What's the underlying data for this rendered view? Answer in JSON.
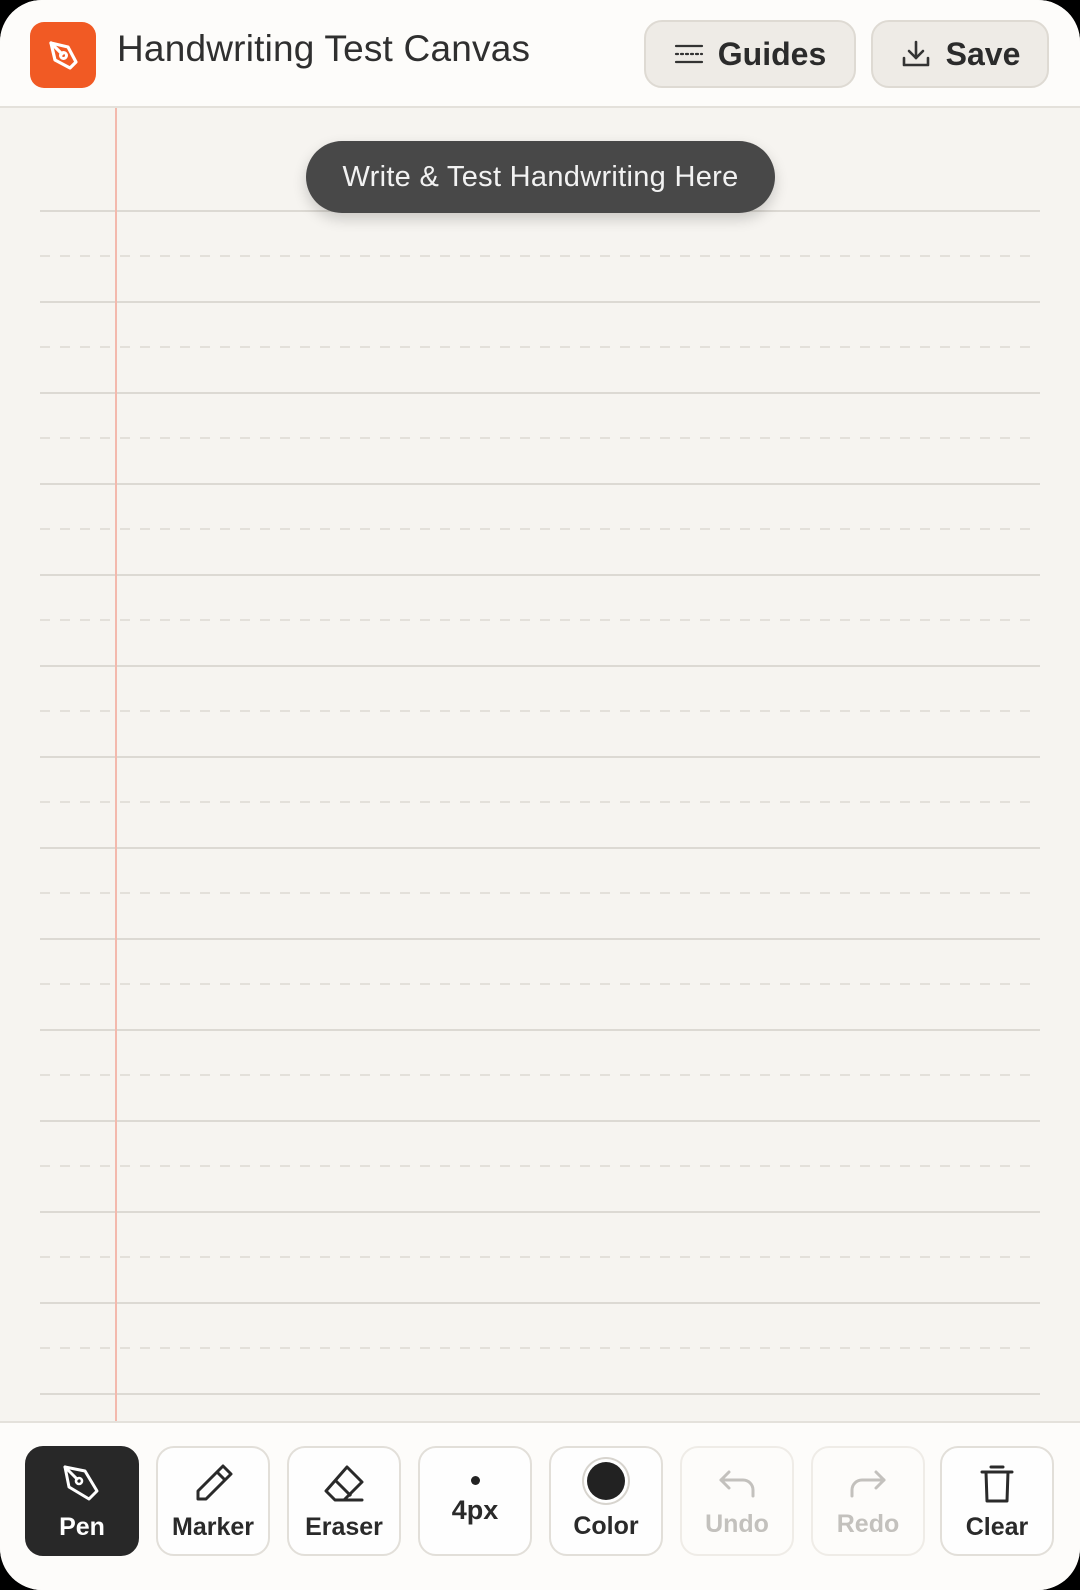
{
  "header": {
    "title": "Handwriting Test Canvas",
    "guides_label": "Guides",
    "save_label": "Save",
    "logo_icon": "pen-nib-icon",
    "accent_color": "#f15a24"
  },
  "canvas": {
    "banner_text": "Write & Test Handwriting Here",
    "paper_color": "#f6f4f0",
    "margin_line_color": "#f3b9ad"
  },
  "toolbar": {
    "pen_label": "Pen",
    "marker_label": "Marker",
    "eraser_label": "Eraser",
    "size_label": "4px",
    "color_label": "Color",
    "undo_label": "Undo",
    "redo_label": "Redo",
    "clear_label": "Clear",
    "active_tool": "Pen",
    "selected_color": "#222222"
  }
}
